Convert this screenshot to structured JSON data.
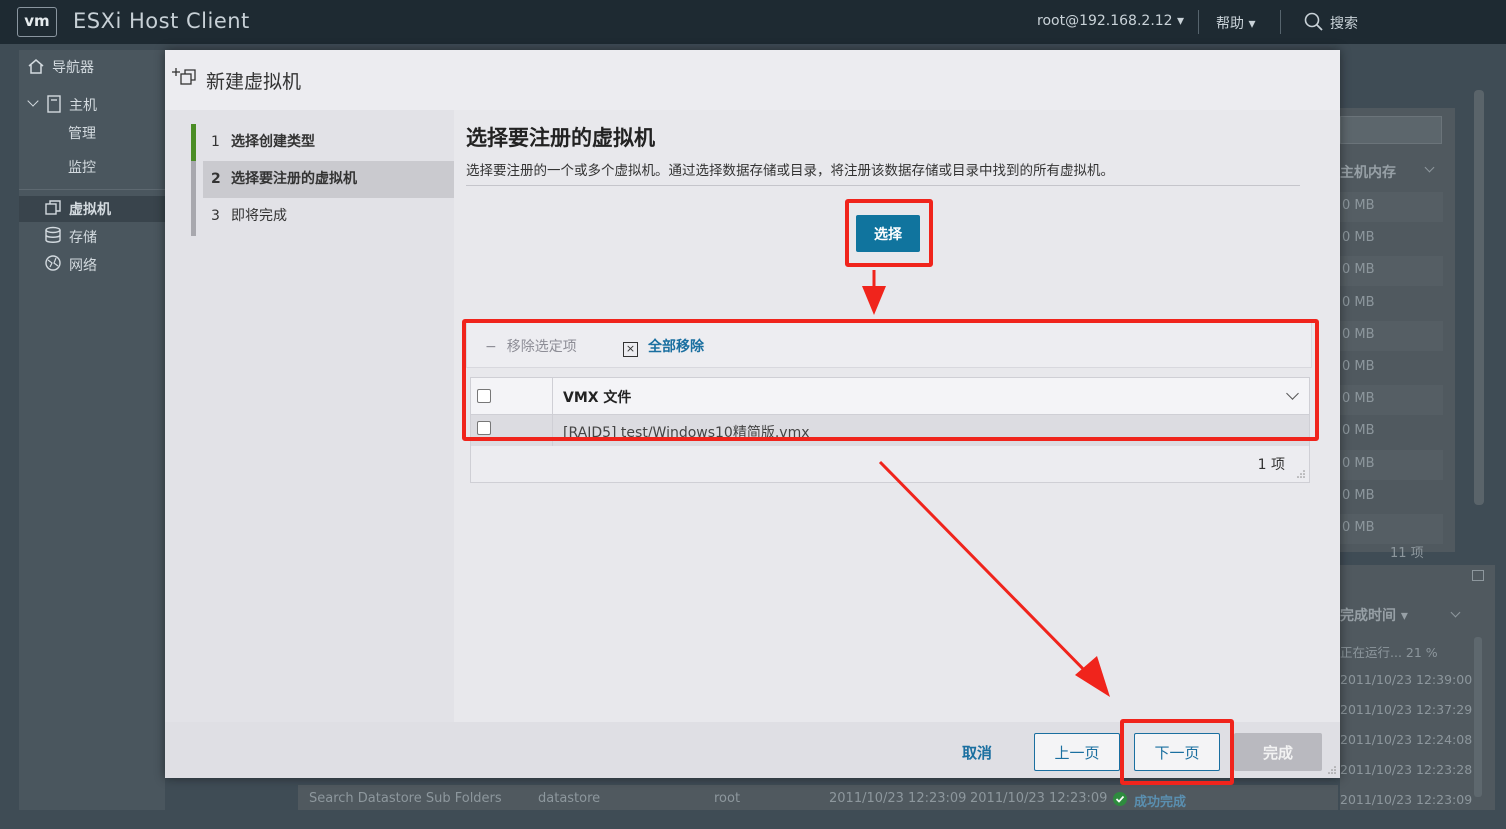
{
  "header": {
    "logo": "vm",
    "app_title": "ESXi Host Client",
    "user": "root@192.168.2.12 ▾",
    "help": "帮助 ▾",
    "search": "搜索"
  },
  "navigator": {
    "title": "导航器",
    "host": "主机",
    "manage": "管理",
    "monitor": "监控",
    "vms": "虚拟机",
    "storage": "存储",
    "network": "网络"
  },
  "background": {
    "column_memory": "主机内存",
    "memory_values": [
      "0 MB",
      "0 MB",
      "0 MB",
      "0 MB",
      "0 MB",
      "0 MB",
      "0 MB",
      "0 MB",
      "0 MB",
      "0 MB",
      "0 MB"
    ],
    "count": "11 项",
    "column_completed": "完成时间 ▾",
    "task_times": [
      "正在运行... 21 %",
      "2011/10/23 12:39:00",
      "2011/10/23 12:37:29",
      "2011/10/23 12:24:08",
      "2011/10/23 12:23:28",
      "2011/10/23 12:23:09"
    ],
    "bottom_row": {
      "task": "Search Datastore Sub Folders",
      "target": "datastore",
      "initiator": "root",
      "queued": "2011/10/23 12:23:09",
      "started": "2011/10/23 12:23:09",
      "result": "成功完成"
    }
  },
  "dialog": {
    "title": "新建虚拟机",
    "steps": [
      {
        "num": "1",
        "label": "选择创建类型"
      },
      {
        "num": "2",
        "label": "选择要注册的虚拟机"
      },
      {
        "num": "3",
        "label": "即将完成"
      }
    ],
    "content_title": "选择要注册的虚拟机",
    "content_desc": "选择要注册的一个或多个虚拟机。通过选择数据存储或目录，将注册该数据存储或目录中找到的所有虚拟机。",
    "select_label": "选择",
    "remove_selected": "移除选定项",
    "remove_all": "全部移除",
    "grid": {
      "header": "VMX 文件",
      "rows": [
        "[RAID5] test/Windows10精简版.vmx"
      ],
      "footer": "1 项"
    },
    "footer": {
      "cancel": "取消",
      "prev": "上一页",
      "next": "下一页",
      "finish": "完成"
    }
  },
  "colors": {
    "accent": "#10749e",
    "highlight": "#f0241c",
    "success": "#2e8b3e"
  }
}
